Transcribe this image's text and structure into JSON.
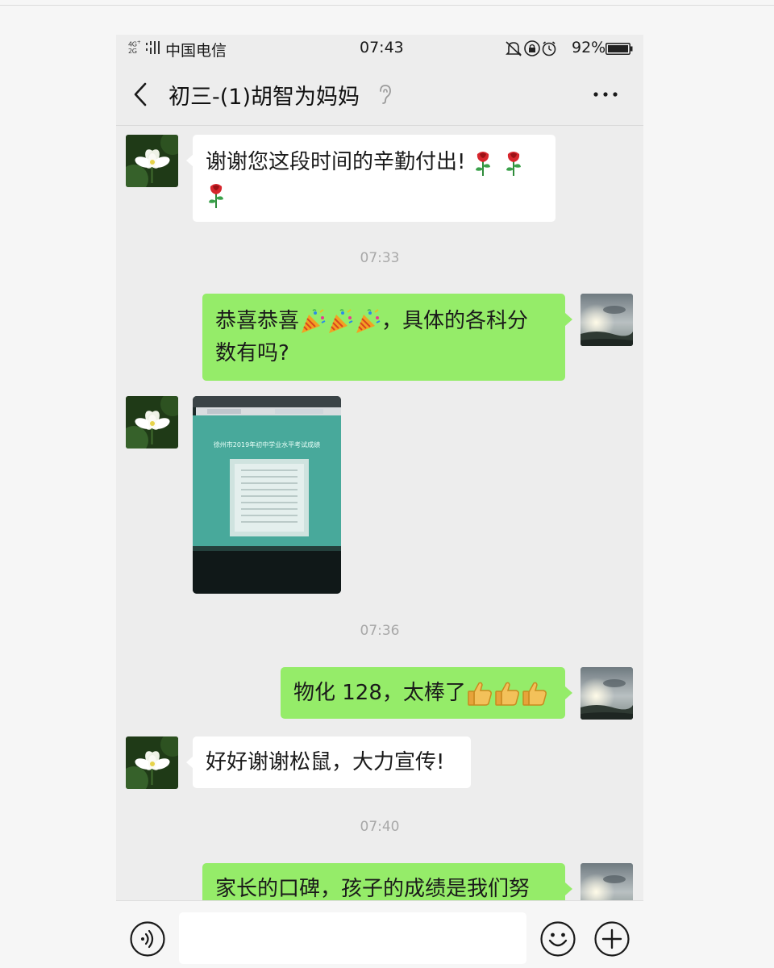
{
  "status_bar": {
    "network": "4G⁺ 2G",
    "carrier": "中国电信",
    "time": "07:43",
    "battery_percent": "92%",
    "icons": [
      "mute-icon",
      "rotation-lock-icon",
      "alarm-icon",
      "battery-icon"
    ]
  },
  "header": {
    "title": "初三-(1)胡智为妈妈",
    "back_icon": "chevron-left-icon",
    "earpiece_icon": "ear-icon",
    "more_icon": "ellipsis-icon"
  },
  "messages": [
    {
      "side": "left",
      "text": "谢谢您这段时间的辛勤付出!",
      "text_line2": "",
      "emoji": "rose",
      "emoji_count": 3
    },
    {
      "type": "timestamp",
      "text": "07:33"
    },
    {
      "side": "right",
      "text": "恭喜恭喜",
      "text_after": "，具体的各科分",
      "text_line2": "数有吗?",
      "emoji": "party-popper",
      "emoji_count": 3
    },
    {
      "side": "left",
      "type": "image",
      "caption": "徐州市2019年初中学业水平考试成绩"
    },
    {
      "type": "timestamp",
      "text": "07:36"
    },
    {
      "side": "right",
      "text": "物化 128，太棒了",
      "emoji": "thumbs-up",
      "emoji_count": 3
    },
    {
      "side": "left",
      "text": "好好谢谢松鼠，大力宣传!"
    },
    {
      "type": "timestamp",
      "text": "07:40"
    },
    {
      "side": "right",
      "text": "家长的口碑，孩子的成绩是我们努"
    }
  ],
  "input_bar": {
    "voice_icon": "voice-icon",
    "input_value": "",
    "emoji_icon": "smiley-icon",
    "plus_icon": "plus-icon"
  },
  "colors": {
    "chat_background": "#ededed",
    "bubble_sent": "#95ec69",
    "bubble_received": "#ffffff",
    "timestamp_text": "#a8a8a8"
  }
}
